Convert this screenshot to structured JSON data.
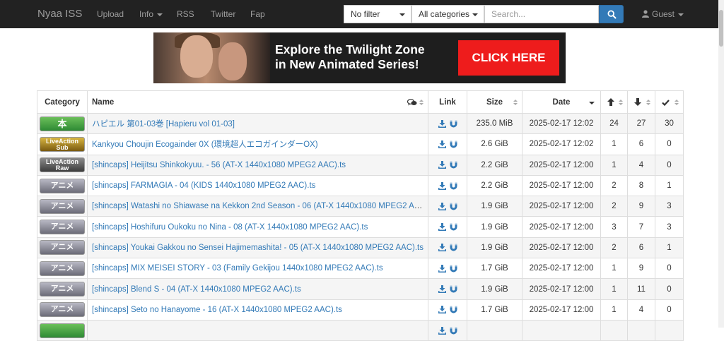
{
  "navbar": {
    "brand": "Nyaa ISS",
    "links": [
      {
        "label": "Upload"
      },
      {
        "label": "Info"
      },
      {
        "label": "RSS"
      },
      {
        "label": "Twitter"
      },
      {
        "label": "Fap"
      }
    ],
    "filter": {
      "selected": "No filter"
    },
    "category": {
      "selected": "All categories"
    },
    "search": {
      "placeholder": "Search..."
    },
    "user": "Guest"
  },
  "banner": {
    "text_line1": "Explore the Twilight Zone",
    "text_line2": "in New Animated Series!",
    "cta": "CLICK HERE"
  },
  "table": {
    "headers": {
      "category": "Category",
      "name": "Name",
      "link": "Link",
      "size": "Size",
      "date": "Date"
    },
    "rows": [
      {
        "category": "本",
        "cat_style": "literature",
        "name": "ハピエル 第01-03巻 [Hapieru vol 01-03]",
        "size": "235.0 MiB",
        "date": "2025-02-17 12:02",
        "seeders": "24",
        "leechers": "27",
        "completed": "30"
      },
      {
        "category": "LiveAction Sub",
        "cat_style": "sub",
        "name": "Kankyou Choujin Ecogainder 0X (環境超人エコガインダーOX)",
        "size": "2.6 GiB",
        "date": "2025-02-17 12:02",
        "seeders": "1",
        "leechers": "6",
        "completed": "0"
      },
      {
        "category": "LiveAction Raw",
        "cat_style": "raw",
        "name": "[shincaps] Heijitsu Shinkokyuu. - 56 (AT-X 1440x1080 MPEG2 AAC).ts",
        "size": "2.2 GiB",
        "date": "2025-02-17 12:00",
        "seeders": "1",
        "leechers": "4",
        "completed": "0"
      },
      {
        "category": "アニメ",
        "cat_style": "anime",
        "name": "[shincaps] FARMAGIA - 04 (KIDS 1440x1080 MPEG2 AAC).ts",
        "size": "2.2 GiB",
        "date": "2025-02-17 12:00",
        "seeders": "2",
        "leechers": "8",
        "completed": "1"
      },
      {
        "category": "アニメ",
        "cat_style": "anime",
        "name": "[shincaps] Watashi no Shiawase na Kekkon 2nd Season - 06 (AT-X 1440x1080 MPEG2 AA...",
        "size": "1.9 GiB",
        "date": "2025-02-17 12:00",
        "seeders": "2",
        "leechers": "9",
        "completed": "3"
      },
      {
        "category": "アニメ",
        "cat_style": "anime",
        "name": "[shincaps] Hoshifuru Oukoku no Nina - 08 (AT-X 1440x1080 MPEG2 AAC).ts",
        "size": "1.9 GiB",
        "date": "2025-02-17 12:00",
        "seeders": "3",
        "leechers": "7",
        "completed": "3"
      },
      {
        "category": "アニメ",
        "cat_style": "anime",
        "name": "[shincaps] Youkai Gakkou no Sensei Hajimemashita! - 05 (AT-X 1440x1080 MPEG2 AAC).ts",
        "size": "1.9 GiB",
        "date": "2025-02-17 12:00",
        "seeders": "2",
        "leechers": "6",
        "completed": "1"
      },
      {
        "category": "アニメ",
        "cat_style": "anime",
        "name": "[shincaps] MIX MEISEI STORY - 03 (Family Gekijou 1440x1080 MPEG2 AAC).ts",
        "size": "1.7 GiB",
        "date": "2025-02-17 12:00",
        "seeders": "1",
        "leechers": "9",
        "completed": "0"
      },
      {
        "category": "アニメ",
        "cat_style": "anime",
        "name": "[shincaps] Blend S - 04 (AT-X 1440x1080 MPEG2 AAC).ts",
        "size": "1.9 GiB",
        "date": "2025-02-17 12:00",
        "seeders": "1",
        "leechers": "11",
        "completed": "0"
      },
      {
        "category": "アニメ",
        "cat_style": "anime",
        "name": "[shincaps] Seto no Hanayome - 16 (AT-X 1440x1080 MPEG2 AAC).ts",
        "size": "1.7 GiB",
        "date": "2025-02-17 12:00",
        "seeders": "1",
        "leechers": "4",
        "completed": "0"
      },
      {
        "category": "",
        "cat_style": "literature",
        "name": "",
        "size": "",
        "date": "",
        "seeders": "",
        "leechers": "",
        "completed": ""
      }
    ]
  },
  "colors": {
    "navbar_bg": "#222222",
    "link": "#337ab7",
    "seeders": "#3c763d",
    "leechers": "#d9534f",
    "search_button": "#337ab7"
  },
  "icons": {
    "user": "user-icon",
    "search": "search-icon",
    "comments": "comments-icon",
    "download": "download-icon",
    "magnet": "magnet-icon",
    "seeders": "arrow-up-icon",
    "leechers": "arrow-down-icon",
    "completed": "check-icon"
  }
}
